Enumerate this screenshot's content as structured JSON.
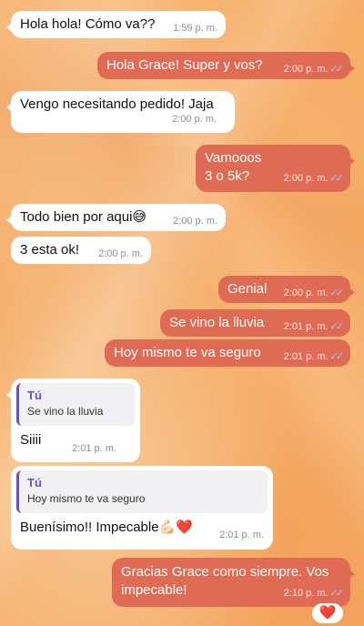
{
  "messages": [
    {
      "text": "Hola hola! Cómo va??",
      "time": "1:59 p. m."
    },
    {
      "text": "Hola Grace! Super y vos?",
      "time": "2:00 p. m."
    },
    {
      "text": "Vengo necesitando pedido! Jaja",
      "time": "2:00 p. m."
    },
    {
      "line1": "Vamooos",
      "line2": "3 o 5k?",
      "time": "2:00 p. m."
    },
    {
      "text": "Todo bien por aqui😅",
      "time": "2:00 p. m."
    },
    {
      "text": "3 esta ok!",
      "time": "2:00 p. m."
    },
    {
      "text": "Genial",
      "time": "2:00 p. m."
    },
    {
      "text": "Se vino la lluvia",
      "time": "2:01 p. m."
    },
    {
      "text": "Hoy mismo te va seguro",
      "time": "2:01 p. m."
    },
    {
      "quote_author": "Tú",
      "quote_text": "Se vino la lluvia",
      "text": "Siiii",
      "time": "2:01 p. m."
    },
    {
      "quote_author": "Tú",
      "quote_text": "Hoy mismo te va seguro",
      "text": "Buenísimo!! Impecable💪🏻❤️",
      "time": "2:01 p. m."
    },
    {
      "line1": "Gracias Grace como siempre. Vos",
      "line2": "impecable!",
      "time": "2:10 p. m."
    }
  ],
  "reaction": "❤️",
  "read_ticks": "✓✓",
  "colors": {
    "outgoing": "#e06b55",
    "incoming": "#ffffff",
    "quote_accent": "#6a4fc4"
  }
}
